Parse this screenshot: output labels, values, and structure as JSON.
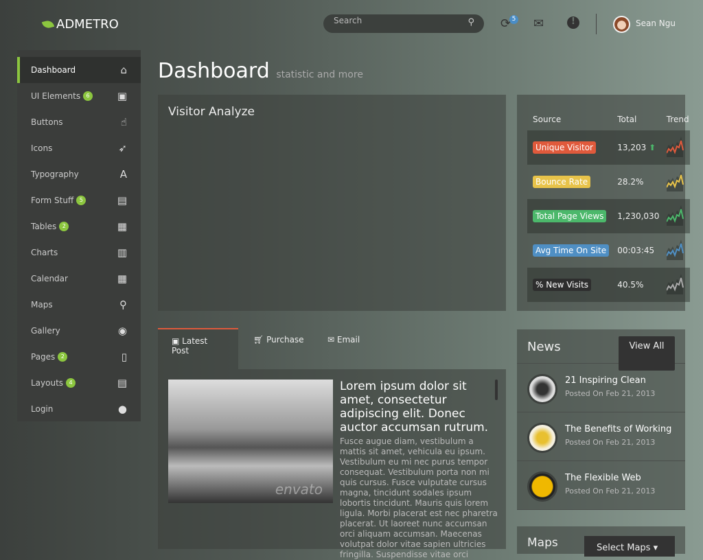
{
  "header": {
    "brand": "ADMETRO",
    "search_placeholder": "Search",
    "sync_badge": "5",
    "user_name": "Sean Ngu"
  },
  "sidebar": {
    "items": [
      {
        "label": "Dashboard",
        "icon": "home-icon",
        "glyph": "⌂",
        "active": true
      },
      {
        "label": "UI Elements",
        "badge": "6",
        "icon": "briefcase-icon",
        "glyph": "▣"
      },
      {
        "label": "Buttons",
        "icon": "hand-pointer-icon",
        "glyph": "☝"
      },
      {
        "label": "Icons",
        "icon": "rocket-icon",
        "glyph": "➶"
      },
      {
        "label": "Typography",
        "icon": "font-icon",
        "glyph": "A"
      },
      {
        "label": "Form Stuff",
        "badge": "5",
        "icon": "file-text-icon",
        "glyph": "▤"
      },
      {
        "label": "Tables",
        "badge": "2",
        "icon": "table-icon",
        "glyph": "▦"
      },
      {
        "label": "Charts",
        "icon": "bar-chart-icon",
        "glyph": "▥"
      },
      {
        "label": "Calendar",
        "icon": "calendar-icon",
        "glyph": "▦"
      },
      {
        "label": "Maps",
        "icon": "map-marker-icon",
        "glyph": "⚲"
      },
      {
        "label": "Gallery",
        "icon": "camera-icon",
        "glyph": "◉"
      },
      {
        "label": "Pages",
        "badge": "2",
        "icon": "file-icon",
        "glyph": "▯"
      },
      {
        "label": "Layouts",
        "badge": "4",
        "icon": "file-alt-icon",
        "glyph": "▤"
      },
      {
        "label": "Login",
        "icon": "user-icon",
        "glyph": "●"
      }
    ]
  },
  "page": {
    "title": "Dashboard",
    "subtitle": "statistic and more"
  },
  "visitor": {
    "title": "Visitor Analyze"
  },
  "stats": {
    "headers": [
      "Source",
      "Total",
      "Trend"
    ],
    "rows": [
      {
        "label": "Unique Visitor",
        "total": "13,203",
        "color": "#e05a3c",
        "up": true
      },
      {
        "label": "Bounce Rate",
        "total": "28.2%",
        "color": "#e8c34a"
      },
      {
        "label": "Total Page Views",
        "total": "1,230,030",
        "color": "#4cb86b"
      },
      {
        "label": "Avg Time On Site",
        "total": "00:03:45",
        "color": "#4f8fc4"
      },
      {
        "label": "% New Visits",
        "total": "40.5%",
        "color": "#2e2e2e",
        "trend_color": "#aaaaaa"
      }
    ]
  },
  "tabs": [
    {
      "label": "Latest Post",
      "icon": "image-icon"
    },
    {
      "label": "Purchase",
      "icon": "cart-icon"
    },
    {
      "label": "Email",
      "icon": "envelope-icon"
    }
  ],
  "post": {
    "heading": "Lorem ipsum dolor sit amet, consectetur adipiscing elit. Donec auctor accumsan rutrum.",
    "body": "Fusce augue diam, vestibulum a mattis sit amet, vehicula eu ipsum. Vestibulum eu mi nec purus tempor consequat. Vestibulum porta non mi quis cursus. Fusce vulputate cursus magna, tincidunt sodales ipsum lobortis tincidunt. Mauris quis lorem ligula. Morbi placerat est nec pharetra placerat. Ut laoreet nunc accumsan orci aliquam accumsan. Maecenas volutpat dolor vitae sapien ultricies fringilla. Suspendisse vitae orci",
    "watermark": "envato"
  },
  "news": {
    "title": "News",
    "view_all": "View All",
    "items": [
      {
        "title": "21 Inspiring Clean",
        "date": "Posted On Feb 21, 2013"
      },
      {
        "title": "The Benefits of Working",
        "date": "Posted On Feb 21, 2013"
      },
      {
        "title": "The Flexible Web",
        "date": "Posted On Feb 21, 2013"
      }
    ]
  },
  "maps": {
    "title": "Maps",
    "select": "Select Maps"
  }
}
